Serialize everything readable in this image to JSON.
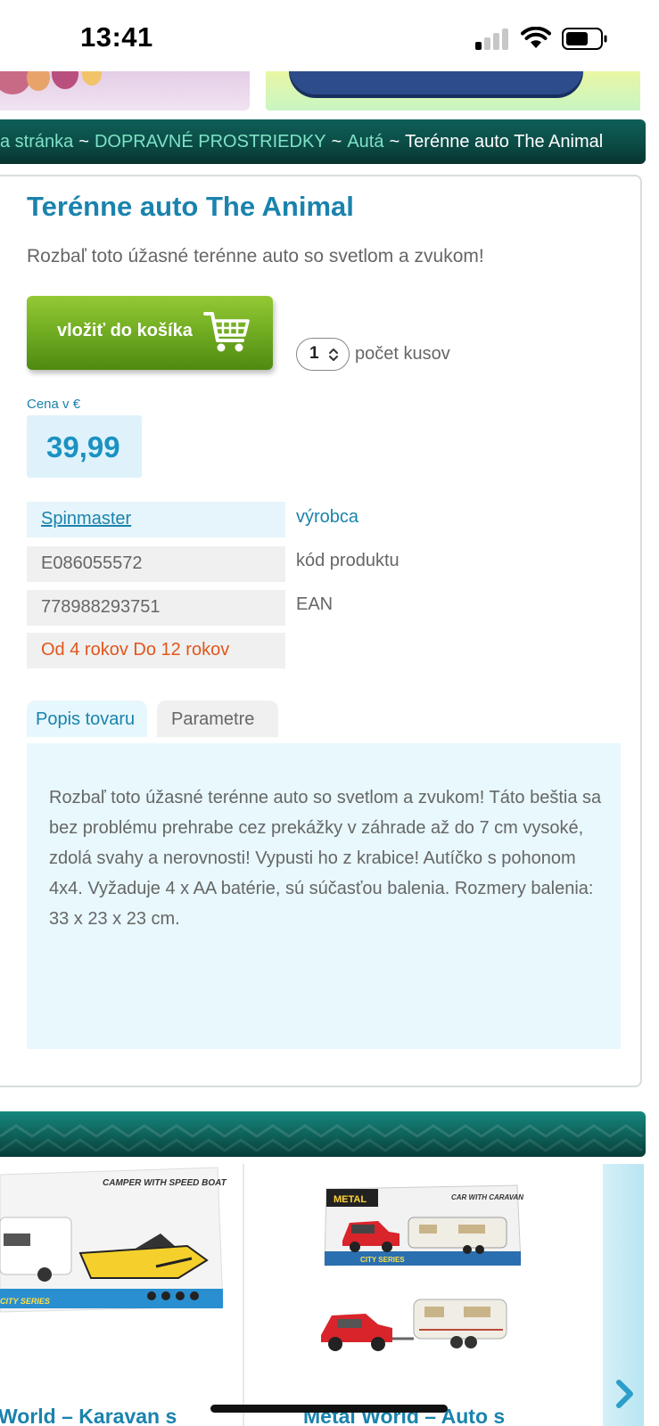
{
  "status_bar": {
    "time": "13:41",
    "icons": [
      "cellular-signal-icon",
      "wifi-icon",
      "battery-icon"
    ]
  },
  "breadcrumb": {
    "items": [
      {
        "label": "a stránka",
        "type": "link"
      },
      {
        "label": "~",
        "type": "separator"
      },
      {
        "label": "DOPRAVNÉ PROSTRIEDKY",
        "type": "link"
      },
      {
        "label": "~",
        "type": "separator"
      },
      {
        "label": "Autá",
        "type": "link"
      },
      {
        "label": "~",
        "type": "separator"
      },
      {
        "label": "Terénne auto The Animal",
        "type": "current"
      }
    ]
  },
  "product": {
    "title": "Terénne auto The Animal",
    "lead": "Rozbaľ toto úžasné terénne auto so svetlom a zvukom!",
    "cart_button_label": "vložiť do košíka",
    "quantity_value": "1",
    "quantity_label": "počet kusov",
    "price_caption": "Cena v €",
    "price": "39,99",
    "attributes": {
      "brand_value": "Spinmaster",
      "brand_label": "výrobca",
      "code_value": "E086055572",
      "code_label": "kód produktu",
      "ean_value": "778988293751",
      "ean_label": "EAN",
      "age_value": "Od 4 rokov Do 12 rokov"
    },
    "tabs": {
      "description_tab": "Popis tovaru",
      "parameters_tab": "Parametre"
    },
    "description": "Rozbaľ toto úžasné terénne auto so svetlom a zvukom! Táto beštia sa bez problému prehrabe cez prekážky v záhrade až do 7 cm vysoké, zdolá svahy a nerovnosti! Vypusti ho z krabice! Autíčko s pohonom 4x4. Vyžaduje 4 x AA batérie, sú súčasťou balenia. Rozmery balenia: 33 x 23 x 23 cm."
  },
  "related": {
    "products": [
      {
        "title": "World – Karavan s",
        "box_heading": "CAMPER WITH SPEED BOAT",
        "box_series": "CITY SERIES"
      },
      {
        "title": "Metal World – Auto s",
        "box_heading": "CAR WITH CARAVAN",
        "box_brand": "METAL",
        "box_series": "CITY SERIES"
      }
    ],
    "next_icon": "chevron-right-icon"
  },
  "colors": {
    "accent_blue": "#1a83ad",
    "breadcrumb_link": "#7ee2c6",
    "cart_green": "#6ca81f",
    "age_orange": "#e0561b",
    "description_bg": "#e8f8fd",
    "band_teal": "#0e5f58"
  }
}
